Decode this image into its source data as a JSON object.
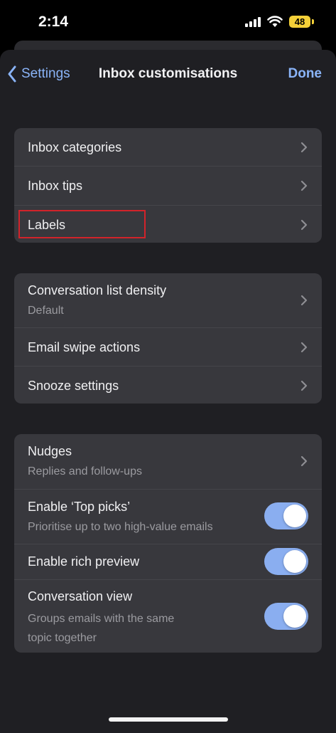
{
  "status_bar": {
    "time": "2:14",
    "battery": "48"
  },
  "nav": {
    "back_label": "Settings",
    "title": "Inbox customisations",
    "done_label": "Done"
  },
  "group1": {
    "items": [
      {
        "label": "Inbox categories"
      },
      {
        "label": "Inbox tips"
      },
      {
        "label": "Labels"
      }
    ]
  },
  "group2": {
    "items": [
      {
        "label": "Conversation list density",
        "sublabel": "Default"
      },
      {
        "label": "Email swipe actions"
      },
      {
        "label": "Snooze settings"
      }
    ]
  },
  "group3": {
    "items": [
      {
        "label": "Nudges",
        "sublabel": "Replies and follow-ups"
      },
      {
        "label": "Enable ‘Top picks’",
        "sublabel": "Prioritise up to two high-value emails",
        "enabled": true
      },
      {
        "label": "Enable rich preview",
        "enabled": true
      },
      {
        "label": "Conversation view",
        "sublabel_line1": "Groups emails with the same",
        "sublabel_line2": "topic together",
        "enabled": true
      }
    ]
  },
  "colors": {
    "accent": "#8ab4f8",
    "toggle_on": "#8aaef0",
    "highlight": "#d2232a"
  }
}
